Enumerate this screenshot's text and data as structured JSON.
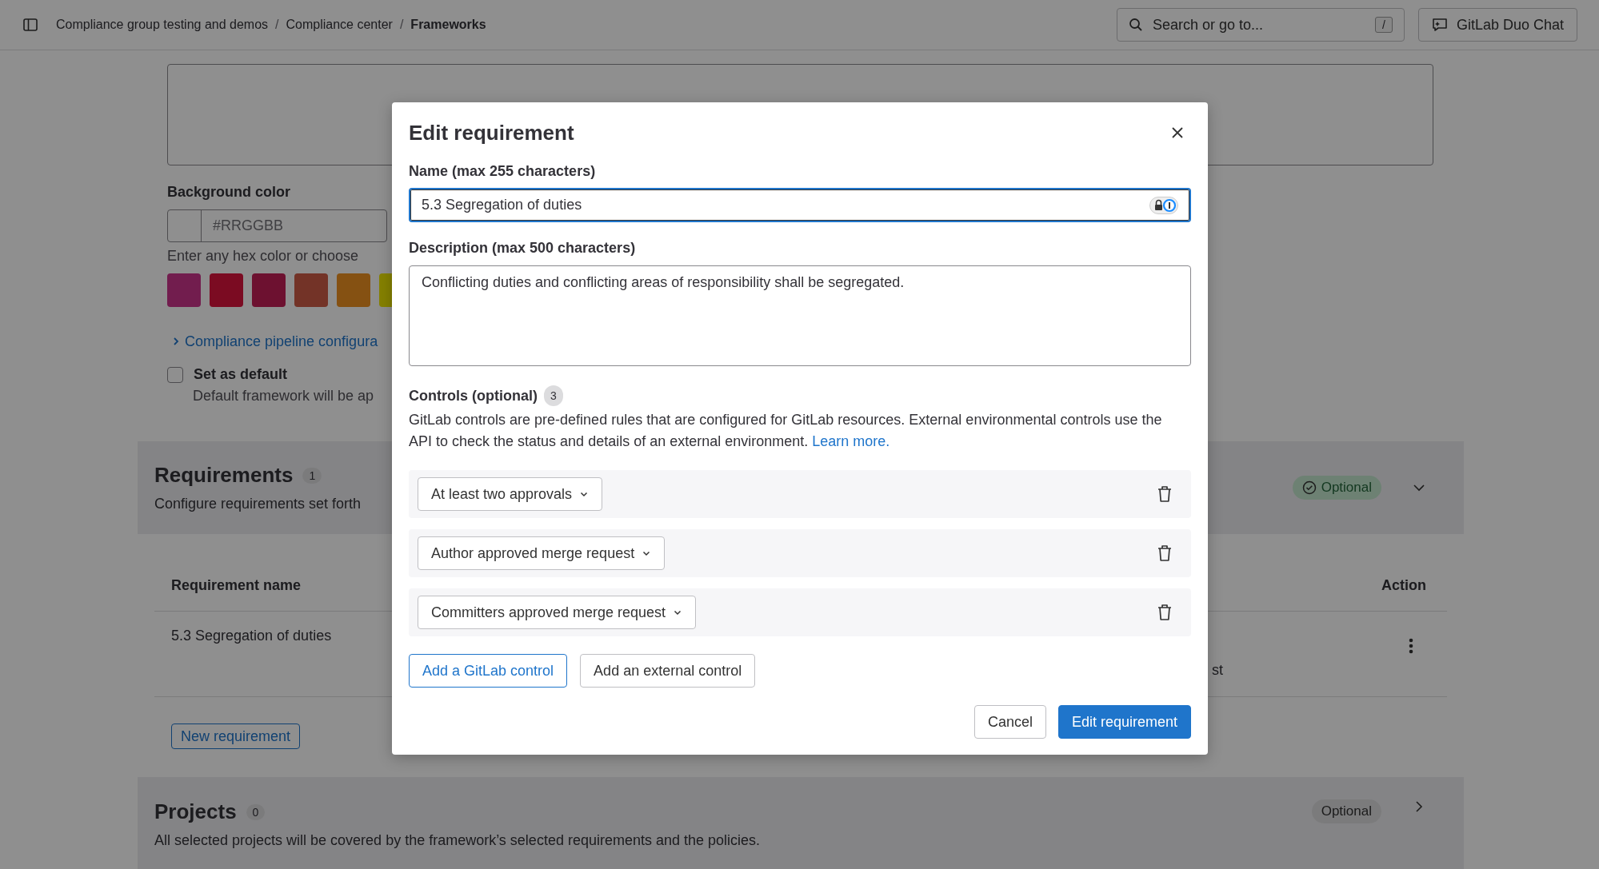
{
  "header": {
    "breadcrumbs": [
      {
        "label": "Compliance group testing and demos",
        "current": false
      },
      {
        "label": "Compliance center",
        "current": false
      },
      {
        "label": "Frameworks",
        "current": true
      }
    ],
    "separator": "/",
    "search": {
      "placeholder": "Search or go to...",
      "shortcut": "/"
    },
    "duo_button": "GitLab Duo Chat"
  },
  "form": {
    "background_color": {
      "label": "Background color",
      "placeholder": "#RRGGBB",
      "hint": "Enter any hex color or choose",
      "swatches": [
        {
          "color": "#721d4e"
        },
        {
          "color": "#7b0b22"
        },
        {
          "color": "#6d1130"
        },
        {
          "color": "#733327"
        },
        {
          "color": "#855112"
        },
        {
          "color": "#858100"
        }
      ]
    },
    "pipeline_link": "Compliance pipeline configura",
    "default_checkbox": {
      "label": "Set as default",
      "checked": false,
      "hint": "Default framework will be ap"
    }
  },
  "requirements": {
    "title": "Requirements",
    "count": "1",
    "subtitle": "Configure requirements set forth",
    "badge": {
      "label": "Optional",
      "kind": "success"
    },
    "expanded": true,
    "table": {
      "columns": [
        "Requirement name",
        "Action"
      ],
      "rows": [
        {
          "name": "5.3 Segregation of duties",
          "column_2": "st"
        }
      ]
    },
    "new_button": "New requirement"
  },
  "projects": {
    "title": "Projects",
    "count": "0",
    "subtitle": "All selected projects will be covered by the framework’s selected requirements and the policies.",
    "badge": {
      "label": "Optional",
      "kind": "neutral"
    },
    "expanded": false
  },
  "modal": {
    "title": "Edit requirement",
    "name_field": {
      "label": "Name (max 255 characters)",
      "value": "5.3 Segregation of duties",
      "focused": true
    },
    "description_field": {
      "label": "Description (max 500 characters)",
      "value": "Conflicting duties and conflicting areas of responsibility shall be segregated."
    },
    "controls": {
      "label": "Controls (optional)",
      "count": "3",
      "help": "GitLab controls are pre-defined rules that are configured for GitLab resources. External environmental controls use the API to check the status and details of an external environment.",
      "link": "Learn more.",
      "items": [
        {
          "label": "At least two approvals"
        },
        {
          "label": "Author approved merge request"
        },
        {
          "label": "Committers approved merge request"
        }
      ]
    },
    "add_buttons": [
      {
        "label": "Add a GitLab control",
        "kind": "primary"
      },
      {
        "label": "Add an external control",
        "kind": "default"
      }
    ],
    "footer_buttons": [
      {
        "label": "Cancel",
        "kind": "default"
      },
      {
        "label": "Edit requirement",
        "kind": "confirm"
      }
    ]
  }
}
